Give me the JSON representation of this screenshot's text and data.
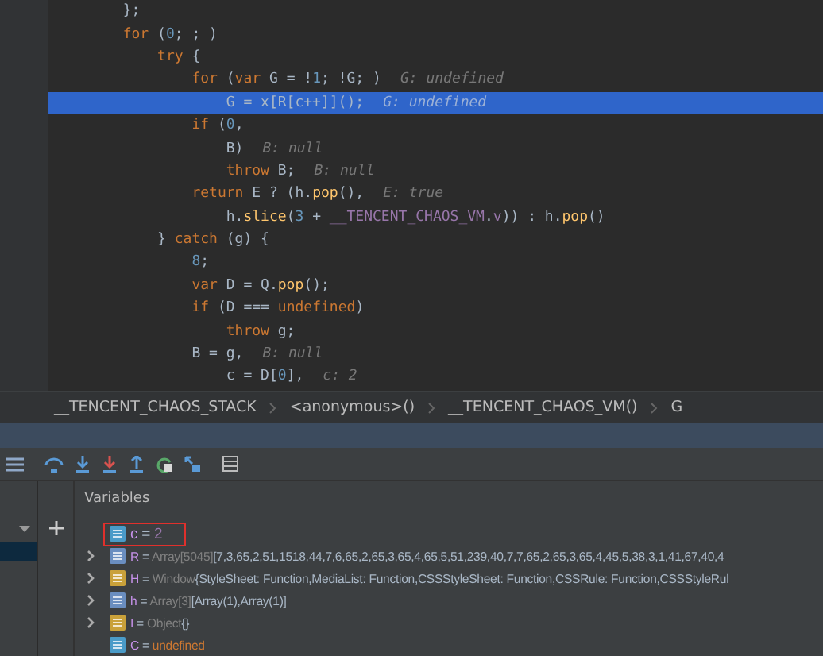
{
  "editor": {
    "lines": [
      {
        "selected": false,
        "segments": [
          {
            "kind": "plain",
            "text": "        };"
          }
        ]
      },
      {
        "selected": false,
        "segments": [
          {
            "kind": "kw",
            "text": "        for"
          },
          {
            "kind": "plain",
            "text": " ("
          },
          {
            "kind": "num",
            "text": "0"
          },
          {
            "kind": "plain",
            "text": "; ; )"
          }
        ]
      },
      {
        "selected": false,
        "segments": [
          {
            "kind": "kw",
            "text": "            try"
          },
          {
            "kind": "plain",
            "text": " {"
          }
        ]
      },
      {
        "selected": false,
        "segments": [
          {
            "kind": "kw",
            "text": "                for"
          },
          {
            "kind": "plain",
            "text": " ("
          },
          {
            "kind": "kw",
            "text": "var"
          },
          {
            "kind": "plain",
            "text": " G = !"
          },
          {
            "kind": "num",
            "text": "1"
          },
          {
            "kind": "plain",
            "text": "; !G; )"
          }
        ],
        "hint": "G: undefined"
      },
      {
        "selected": true,
        "segments": [
          {
            "kind": "plain",
            "text": "                    G = x[R[c++]]();"
          }
        ],
        "hint": "G: undefined"
      },
      {
        "selected": false,
        "segments": [
          {
            "kind": "kw",
            "text": "                if"
          },
          {
            "kind": "plain",
            "text": " ("
          },
          {
            "kind": "num",
            "text": "0"
          },
          {
            "kind": "plain",
            "text": ","
          }
        ]
      },
      {
        "selected": false,
        "segments": [
          {
            "kind": "plain",
            "text": "                    B)"
          }
        ],
        "hint": "B: null"
      },
      {
        "selected": false,
        "segments": [
          {
            "kind": "kw",
            "text": "                    throw"
          },
          {
            "kind": "plain",
            "text": " B;"
          }
        ],
        "hint": "B: null"
      },
      {
        "selected": false,
        "segments": [
          {
            "kind": "kw",
            "text": "                return"
          },
          {
            "kind": "plain",
            "text": " E ? (h."
          },
          {
            "kind": "fn",
            "text": "pop"
          },
          {
            "kind": "plain",
            "text": "(),"
          }
        ],
        "hint": "E: true"
      },
      {
        "selected": false,
        "segments": [
          {
            "kind": "plain",
            "text": "                    h."
          },
          {
            "kind": "fn",
            "text": "slice"
          },
          {
            "kind": "plain",
            "text": "("
          },
          {
            "kind": "num",
            "text": "3"
          },
          {
            "kind": "plain",
            "text": " + "
          },
          {
            "kind": "global",
            "text": "__TENCENT_CHAOS_VM"
          },
          {
            "kind": "plain",
            "text": "."
          },
          {
            "kind": "global",
            "text": "v"
          },
          {
            "kind": "plain",
            "text": ")) : h."
          },
          {
            "kind": "fn",
            "text": "pop"
          },
          {
            "kind": "plain",
            "text": "()"
          }
        ]
      },
      {
        "selected": false,
        "segments": [
          {
            "kind": "plain",
            "text": "            } "
          },
          {
            "kind": "kw",
            "text": "catch"
          },
          {
            "kind": "plain",
            "text": " (g) {"
          }
        ]
      },
      {
        "selected": false,
        "segments": [
          {
            "kind": "num",
            "text": "                8"
          },
          {
            "kind": "plain",
            "text": ";"
          }
        ]
      },
      {
        "selected": false,
        "segments": [
          {
            "kind": "kw",
            "text": "                var"
          },
          {
            "kind": "plain",
            "text": " D = Q."
          },
          {
            "kind": "fn",
            "text": "pop"
          },
          {
            "kind": "plain",
            "text": "();"
          }
        ]
      },
      {
        "selected": false,
        "segments": [
          {
            "kind": "kw",
            "text": "                if"
          },
          {
            "kind": "plain",
            "text": " (D === "
          },
          {
            "kind": "kw",
            "text": "undefined"
          },
          {
            "kind": "plain",
            "text": ")"
          }
        ]
      },
      {
        "selected": false,
        "segments": [
          {
            "kind": "kw",
            "text": "                    throw"
          },
          {
            "kind": "plain",
            "text": " g;"
          }
        ]
      },
      {
        "selected": false,
        "segments": [
          {
            "kind": "plain",
            "text": "                B = g,"
          }
        ],
        "hint": "B: null"
      },
      {
        "selected": false,
        "segments": [
          {
            "kind": "plain",
            "text": "                    c = D["
          },
          {
            "kind": "num",
            "text": "0"
          },
          {
            "kind": "plain",
            "text": "],"
          }
        ],
        "hint": "c: 2"
      }
    ]
  },
  "breadcrumbs": [
    "__TENCENT_CHAOS_STACK",
    "<anonymous>()",
    "__TENCENT_CHAOS_VM()",
    "G"
  ],
  "variables": {
    "title": "Variables",
    "items": [
      {
        "kind": "number",
        "name": "c",
        "operator": "=",
        "value": "2",
        "expandable": false,
        "boxed": true
      },
      {
        "kind": "array",
        "name": "R",
        "operator": "=",
        "type": "Array[5045]",
        "value": "[7,3,65,2,51,1518,44,7,6,65,2,65,3,65,4,65,5,51,239,40,7,7,65,2,65,3,65,4,45,5,38,3,1,41,67,40,4",
        "expandable": true,
        "boxed": false
      },
      {
        "kind": "object",
        "name": "H",
        "operator": "=",
        "type": "Window",
        "value": "{StyleSheet: Function,MediaList: Function,CSSStyleSheet: Function,CSSRule: Function,CSSStyleRul",
        "expandable": true,
        "boxed": false
      },
      {
        "kind": "array",
        "name": "h",
        "operator": "=",
        "type": "Array[3]",
        "value": "[Array(1),Array(1)]",
        "expandable": true,
        "boxed": false
      },
      {
        "kind": "object",
        "name": "I",
        "operator": "=",
        "type": "Object",
        "value": "{}",
        "expandable": true,
        "boxed": false
      },
      {
        "kind": "undefined",
        "name": "C",
        "operator": "=",
        "value": "undefined",
        "expandable": false,
        "boxed": false
      }
    ]
  }
}
